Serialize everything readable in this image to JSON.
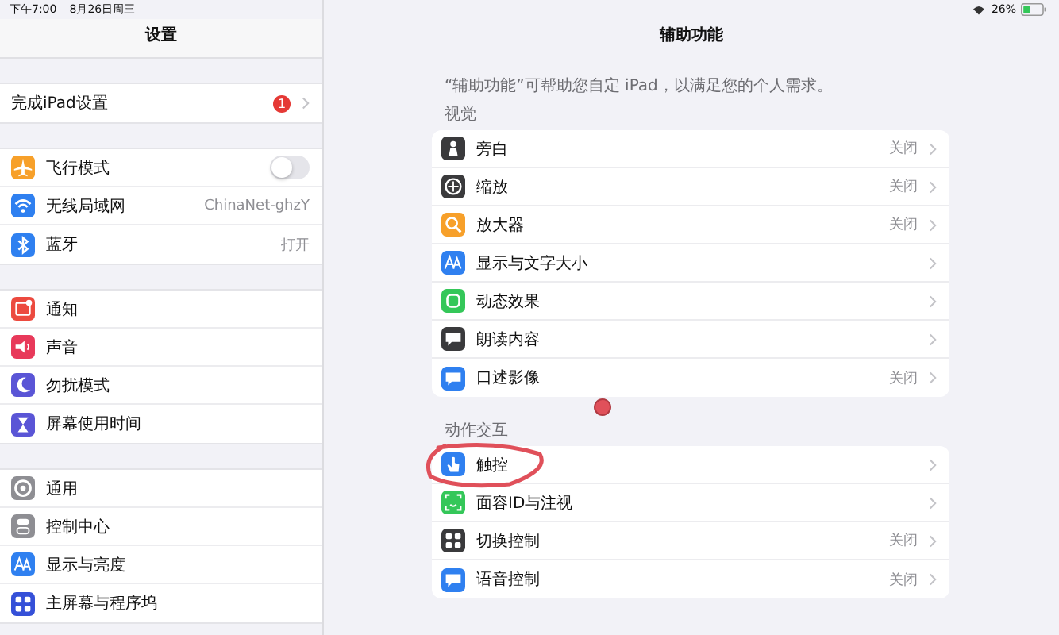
{
  "status_bar": {
    "time": "下午7:00",
    "date": "8月26日周三",
    "battery": "26%"
  },
  "sidebar": {
    "title": "设置",
    "groups": [
      {
        "items": [
          {
            "label": "完成iPad设置",
            "badge": "1"
          }
        ]
      },
      {
        "items": [
          {
            "label": "飞行模式",
            "kind": "airplane",
            "color": "#f7a02a",
            "on": false
          },
          {
            "label": "无线局域网",
            "kind": "wifi",
            "color": "#2f80f0",
            "value": "ChinaNet-ghzY"
          },
          {
            "label": "蓝牙",
            "kind": "bluetooth",
            "color": "#2f80f0",
            "value": "打开"
          }
        ]
      },
      {
        "items": [
          {
            "label": "通知",
            "kind": "bell",
            "color": "#ec4a3f"
          },
          {
            "label": "声音",
            "kind": "speaker",
            "color": "#e8395a"
          },
          {
            "label": "勿扰模式",
            "kind": "moon",
            "color": "#5a55d6"
          },
          {
            "label": "屏幕使用时间",
            "kind": "hourglass",
            "color": "#5a55d6"
          }
        ]
      },
      {
        "items": [
          {
            "label": "通用",
            "kind": "gear",
            "color": "#8e8e93"
          },
          {
            "label": "控制中心",
            "kind": "switches",
            "color": "#8e8e93"
          },
          {
            "label": "显示与亮度",
            "kind": "text",
            "color": "#2f80f0"
          },
          {
            "label": "主屏幕与程序坞",
            "kind": "grid",
            "color": "#3550d8"
          }
        ]
      }
    ]
  },
  "detail": {
    "title": "辅助功能",
    "caption": "“辅助功能”可帮助您自定 iPad，以满足您的个人需求。",
    "sections": [
      {
        "header": "视觉",
        "items": [
          {
            "label": "旁白",
            "kind": "person",
            "color": "#3a3a3c",
            "value": "关闭"
          },
          {
            "label": "缩放",
            "kind": "target",
            "color": "#3a3a3c",
            "value": "关闭"
          },
          {
            "label": "放大器",
            "kind": "magnifier",
            "color": "#f7a02a",
            "value": "关闭"
          },
          {
            "label": "显示与文字大小",
            "kind": "text",
            "color": "#2f80f0"
          },
          {
            "label": "动态效果",
            "kind": "square",
            "color": "#34c759"
          },
          {
            "label": "朗读内容",
            "kind": "bubble",
            "color": "#3a3a3c"
          },
          {
            "label": "口述影像",
            "kind": "bubble",
            "color": "#2f80f0",
            "value": "关闭"
          }
        ]
      },
      {
        "header": "动作交互",
        "items": [
          {
            "label": "触控",
            "kind": "hand",
            "color": "#2f80f0"
          },
          {
            "label": "面容ID与注视",
            "kind": "face",
            "color": "#34c759"
          },
          {
            "label": "切换控制",
            "kind": "grid",
            "color": "#3a3a3c",
            "value": "关闭"
          },
          {
            "label": "语音控制",
            "kind": "bubble",
            "color": "#2f80f0",
            "value": "关闭"
          }
        ]
      }
    ]
  }
}
